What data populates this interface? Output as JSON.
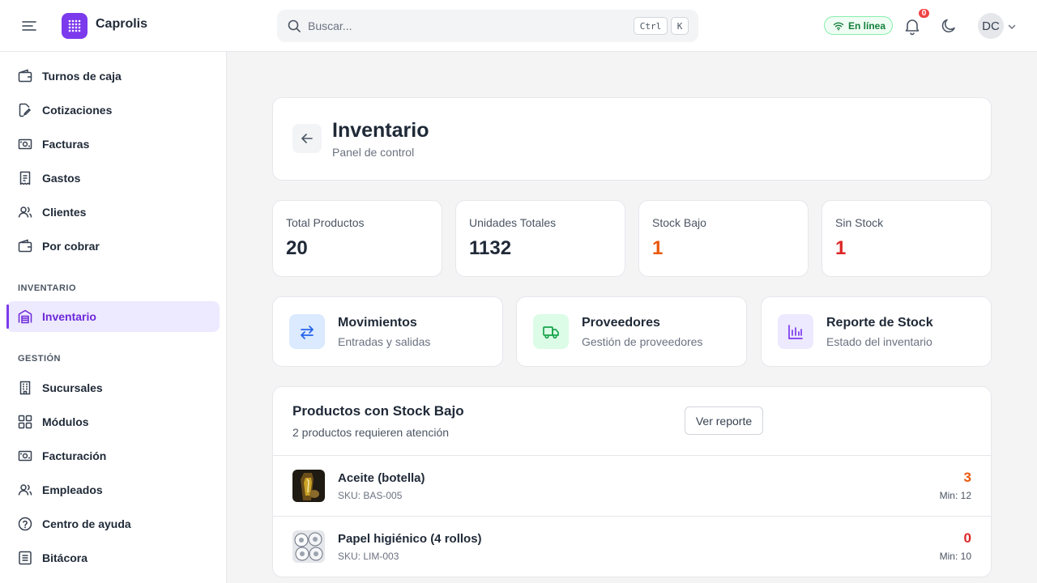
{
  "header": {
    "brand": "Caprolis",
    "search_placeholder": "Buscar...",
    "shortcut_ctrl": "Ctrl",
    "shortcut_key": "K",
    "status_label": "En línea",
    "notification_count": "0",
    "avatar_initials": "DC"
  },
  "sidebar": {
    "items_top": [
      {
        "label": "Turnos de caja",
        "icon": "wallet-icon"
      },
      {
        "label": "Cotizaciones",
        "icon": "pen-document-icon"
      },
      {
        "label": "Facturas",
        "icon": "banknote-icon"
      },
      {
        "label": "Gastos",
        "icon": "receipt-icon"
      },
      {
        "label": "Clientes",
        "icon": "users-icon"
      },
      {
        "label": "Por cobrar",
        "icon": "wallet-icon"
      }
    ],
    "section_inventario": "INVENTARIO",
    "inventario_item": {
      "label": "Inventario",
      "icon": "warehouse-icon"
    },
    "section_gestion": "GESTIÓN",
    "items_gestion": [
      {
        "label": "Sucursales",
        "icon": "building-icon"
      },
      {
        "label": "Módulos",
        "icon": "grid-icon"
      },
      {
        "label": "Facturación",
        "icon": "banknote-icon"
      },
      {
        "label": "Empleados",
        "icon": "users-icon"
      },
      {
        "label": "Centro de ayuda",
        "icon": "help-circle-icon"
      },
      {
        "label": "Bitácora",
        "icon": "log-icon"
      }
    ]
  },
  "page": {
    "title": "Inventario",
    "subtitle": "Panel de control"
  },
  "stats": [
    {
      "label": "Total Productos",
      "value": "20",
      "color": "#1f2937"
    },
    {
      "label": "Unidades Totales",
      "value": "1132",
      "color": "#1f2937"
    },
    {
      "label": "Stock Bajo",
      "value": "1",
      "color": "#ea580c"
    },
    {
      "label": "Sin Stock",
      "value": "1",
      "color": "#dc2626"
    }
  ],
  "actions": [
    {
      "title": "Movimientos",
      "subtitle": "Entradas y salidas",
      "icon": "arrows-exchange-icon",
      "bg": "#dbeafe",
      "fg": "#2563eb"
    },
    {
      "title": "Proveedores",
      "subtitle": "Gestión de proveedores",
      "icon": "truck-icon",
      "bg": "#dcfce7",
      "fg": "#16a34a"
    },
    {
      "title": "Reporte de Stock",
      "subtitle": "Estado del inventario",
      "icon": "bar-chart-icon",
      "bg": "#ede9fe",
      "fg": "#7c3aed"
    }
  ],
  "low_stock": {
    "title": "Productos con Stock Bajo",
    "subtitle": "2 productos requieren atención",
    "button_label": "Ver reporte",
    "items": [
      {
        "name": "Aceite (botella)",
        "sku": "SKU: BAS-005",
        "qty": "3",
        "min": "Min: 12",
        "qty_color": "#ea580c"
      },
      {
        "name": "Papel higiénico (4 rollos)",
        "sku": "SKU: LIM-003",
        "qty": "0",
        "min": "Min: 10",
        "qty_color": "#dc2626"
      }
    ]
  },
  "colors": {
    "accent": "#7c3aed",
    "online": "#15803d",
    "warning": "#ea580c",
    "danger": "#dc2626"
  }
}
